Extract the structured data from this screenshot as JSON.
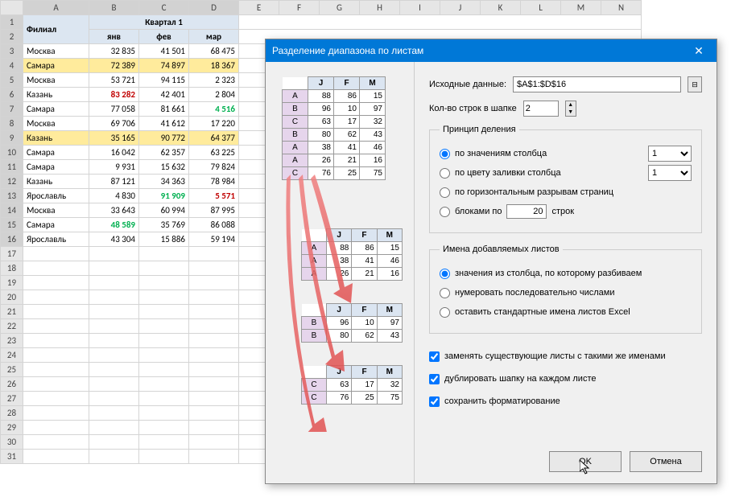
{
  "sheet": {
    "columns": [
      "A",
      "B",
      "C",
      "D",
      "E",
      "F",
      "G",
      "H",
      "I",
      "J",
      "K",
      "L",
      "M",
      "N"
    ],
    "header1": {
      "branch": "Филиал",
      "quarter": "Квартал 1"
    },
    "header2": [
      "янв",
      "фев",
      "мар"
    ],
    "rows": [
      {
        "r": 3,
        "name": "Москва",
        "v": [
          "32 835",
          "41 501",
          "68 475"
        ]
      },
      {
        "r": 4,
        "name": "Самара",
        "v": [
          "72 389",
          "74 897",
          "18 367"
        ],
        "bg": "yellow"
      },
      {
        "r": 5,
        "name": "Москва",
        "v": [
          "53 721",
          "94 115",
          "2 323"
        ]
      },
      {
        "r": 6,
        "name": "Казань",
        "v": [
          "83 282",
          "42 401",
          "2 804"
        ],
        "c0": "red"
      },
      {
        "r": 7,
        "name": "Самара",
        "v": [
          "77 058",
          "81 661",
          "4 516"
        ],
        "c2": "green"
      },
      {
        "r": 8,
        "name": "Москва",
        "v": [
          "69 706",
          "41 612",
          "17 220"
        ]
      },
      {
        "r": 9,
        "name": "Казань",
        "v": [
          "35 165",
          "90 772",
          "64 377"
        ],
        "bg": "yellow"
      },
      {
        "r": 10,
        "name": "Самара",
        "v": [
          "16 042",
          "62 357",
          "63 225"
        ]
      },
      {
        "r": 11,
        "name": "Самара",
        "v": [
          "9 931",
          "15 632",
          "79 824"
        ]
      },
      {
        "r": 12,
        "name": "Казань",
        "v": [
          "87 121",
          "34 363",
          "78 984"
        ]
      },
      {
        "r": 13,
        "name": "Ярославль",
        "v": [
          "4 830",
          "91 909",
          "5 571"
        ],
        "c1": "green",
        "c2": "red"
      },
      {
        "r": 14,
        "name": "Москва",
        "v": [
          "33 643",
          "60 994",
          "87 995"
        ]
      },
      {
        "r": 15,
        "name": "Самара",
        "v": [
          "48 589",
          "35 769",
          "86 088"
        ],
        "c0": "green"
      },
      {
        "r": 16,
        "name": "Ярославль",
        "v": [
          "43 304",
          "15 886",
          "59 194"
        ]
      }
    ],
    "empty_rows": [
      17,
      18,
      19,
      20,
      21,
      22,
      23,
      24,
      25,
      26,
      27,
      28,
      29,
      30,
      31
    ]
  },
  "dialog": {
    "title": "Разделение диапазона по листам",
    "src_label": "Исходные данные:",
    "src_value": "$A$1:$D$16",
    "hdr_rows_label": "Кол-во строк в шапке",
    "hdr_rows_value": "2",
    "group_split": {
      "legend": "Принцип деления",
      "by_col": "по значениям столбца",
      "by_color": "по цвету заливки столбца",
      "by_gaps": "по горизонтальным разрывам страниц",
      "by_blocks_prefix": "блоками по",
      "by_blocks_suffix": "строк",
      "col1_value": "1",
      "col2_value": "1",
      "block_value": "20"
    },
    "group_names": {
      "legend": "Имена добавляемых листов",
      "opt1": "значения из столбца, по которому разбиваем",
      "opt2": "нумеровать последовательно числами",
      "opt3": "оставить стандартные имена листов Excel"
    },
    "chk_replace": "заменять существующие листы с такими же именами",
    "chk_dup": "дублировать шапку на каждом листе",
    "chk_fmt": "сохранить форматирование",
    "btn_ok": "OK",
    "btn_cancel": "Отмена"
  },
  "mini": {
    "hdr": [
      "J",
      "F",
      "M"
    ],
    "main": [
      {
        "l": "A",
        "v": [
          88,
          86,
          15
        ]
      },
      {
        "l": "B",
        "v": [
          96,
          10,
          97
        ]
      },
      {
        "l": "C",
        "v": [
          63,
          17,
          32
        ]
      },
      {
        "l": "B",
        "v": [
          80,
          62,
          43
        ]
      },
      {
        "l": "A",
        "v": [
          38,
          41,
          46
        ]
      },
      {
        "l": "A",
        "v": [
          26,
          21,
          16
        ]
      },
      {
        "l": "C",
        "v": [
          76,
          25,
          75
        ]
      }
    ],
    "a": [
      {
        "l": "A",
        "v": [
          88,
          86,
          15
        ]
      },
      {
        "l": "A",
        "v": [
          38,
          41,
          46
        ]
      },
      {
        "l": "A",
        "v": [
          26,
          21,
          16
        ]
      }
    ],
    "b": [
      {
        "l": "B",
        "v": [
          96,
          10,
          97
        ]
      },
      {
        "l": "B",
        "v": [
          80,
          62,
          43
        ]
      }
    ],
    "c": [
      {
        "l": "C",
        "v": [
          63,
          17,
          32
        ]
      },
      {
        "l": "C",
        "v": [
          76,
          25,
          75
        ]
      }
    ]
  }
}
